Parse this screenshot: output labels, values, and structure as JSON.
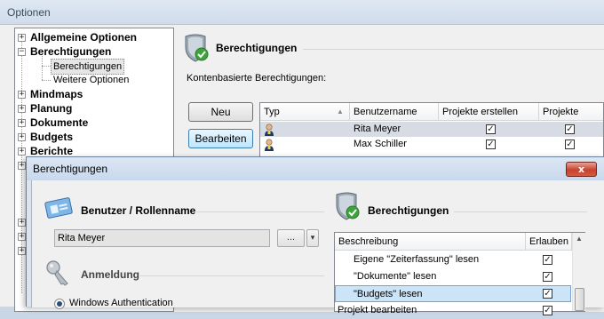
{
  "outer_window": {
    "title": "Optionen"
  },
  "tree": {
    "items": [
      {
        "label": "Allgemeine Optionen",
        "bold": true,
        "expander": "+"
      },
      {
        "label": "Berechtigungen",
        "bold": true,
        "expander": "−"
      },
      {
        "label": "Berechtigungen",
        "bold": false,
        "selected": true
      },
      {
        "label": "Weitere Optionen",
        "bold": false
      },
      {
        "label": "Mindmaps",
        "bold": true,
        "expander": "+"
      },
      {
        "label": "Planung",
        "bold": true,
        "expander": "+"
      },
      {
        "label": "Dokumente",
        "bold": true,
        "expander": "+"
      },
      {
        "label": "Budgets",
        "bold": true,
        "expander": "+"
      },
      {
        "label": "Berichte",
        "bold": true,
        "expander": "+"
      }
    ]
  },
  "right_panel": {
    "section_title": "Berechtigungen",
    "subtitle": "Kontenbasierte Berechtigungen:",
    "buttons": {
      "new": "Neu",
      "edit": "Bearbeiten"
    },
    "grid": {
      "columns": [
        "Typ",
        "Benutzername",
        "Projekte erstellen",
        "Projekte lesen"
      ],
      "rows": [
        {
          "type_icon": "user-icon",
          "username": "Rita Meyer",
          "create": true,
          "read": true,
          "selected": true
        },
        {
          "type_icon": "user-icon",
          "username": "Max Schiller",
          "create": true,
          "read": true,
          "selected": false
        }
      ]
    }
  },
  "dialog": {
    "title": "Berechtigungen",
    "close_label": "x",
    "user_section": {
      "title": "Benutzer / Rollenname",
      "name_value": "Rita Meyer",
      "browse_label": "...",
      "dropdown_glyph": "▾"
    },
    "login_section": {
      "title": "Anmeldung",
      "radio_label": "Windows Authentication"
    },
    "perm_section": {
      "title": "Berechtigungen",
      "col_desc": "Beschreibung",
      "col_allow": "Erlauben",
      "rows": [
        {
          "label": "Eigene \"Zeiterfassung\" lesen",
          "allowed": true,
          "selected": false,
          "indent": true
        },
        {
          "label": "\"Dokumente\" lesen",
          "allowed": true,
          "selected": false,
          "indent": true
        },
        {
          "label": "\"Budgets\" lesen",
          "allowed": true,
          "selected": true,
          "indent": true
        },
        {
          "label": "Projekt bearbeiten",
          "allowed": true,
          "selected": false,
          "indent": false
        }
      ]
    }
  },
  "colors": {
    "title_bar": "#cfdcec",
    "selection": "#cce4f7",
    "close_button": "#c7432f"
  }
}
